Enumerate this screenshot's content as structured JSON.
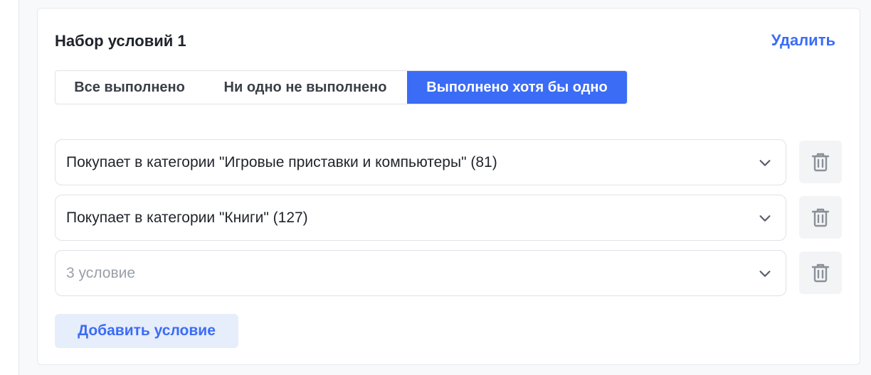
{
  "condition_set": {
    "title": "Набор условий 1",
    "delete_label": "Удалить"
  },
  "modes": [
    {
      "label": "Все выполнено",
      "active": false
    },
    {
      "label": "Ни одно не выполнено",
      "active": false
    },
    {
      "label": "Выполнено хотя бы одно",
      "active": true
    }
  ],
  "conditions": [
    {
      "value": "Покупает в категории \"Игровые приставки и компьютеры\" (81)"
    },
    {
      "value": "Покупает в категории \"Книги\" (127)"
    },
    {
      "value": "",
      "placeholder": "3 условие"
    }
  ],
  "add_label": "Добавить условие",
  "colors": {
    "accent": "#3b6cf6",
    "accent_light": "#e6edfb"
  },
  "icons": {
    "row_action": "trash-icon",
    "dropdown": "chevron-down-icon"
  }
}
